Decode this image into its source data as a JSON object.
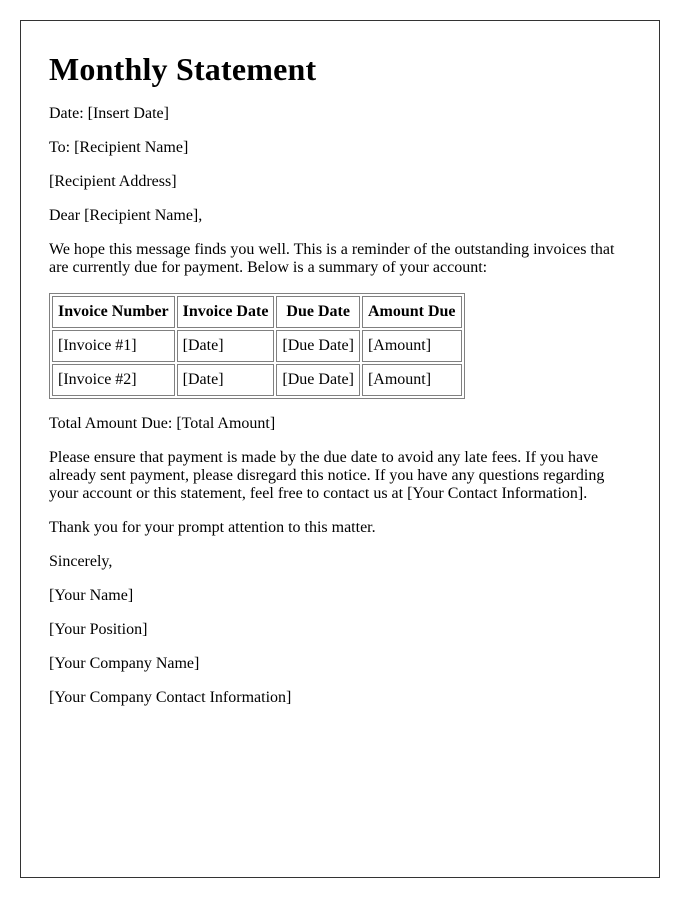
{
  "title": "Monthly Statement",
  "date_line": "Date: [Insert Date]",
  "to_line": "To: [Recipient Name]",
  "address_line": "[Recipient Address]",
  "salutation": "Dear [Recipient Name],",
  "intro": "We hope this message finds you well. This is a reminder of the outstanding invoices that are currently due for payment. Below is a summary of your account:",
  "table": {
    "headers": [
      "Invoice Number",
      "Invoice Date",
      "Due Date",
      "Amount Due"
    ],
    "rows": [
      [
        "[Invoice #1]",
        "[Date]",
        "[Due Date]",
        "[Amount]"
      ],
      [
        "[Invoice #2]",
        "[Date]",
        "[Due Date]",
        "[Amount]"
      ]
    ]
  },
  "total_line": "Total Amount Due: [Total Amount]",
  "payment_note": "Please ensure that payment is made by the due date to avoid any late fees. If you have already sent payment, please disregard this notice. If you have any questions regarding your account or this statement, feel free to contact us at [Your Contact Information].",
  "thanks": "Thank you for your prompt attention to this matter.",
  "closing": "Sincerely,",
  "signature": {
    "name": "[Your Name]",
    "position": "[Your Position]",
    "company": "[Your Company Name]",
    "contact": "[Your Company Contact Information]"
  }
}
